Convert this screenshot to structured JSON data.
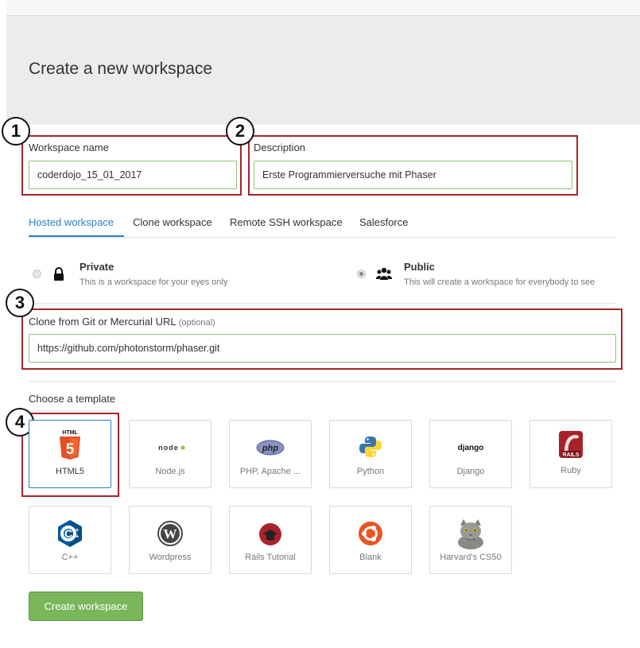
{
  "header": {
    "title": "Create a new workspace"
  },
  "annotations": [
    "1",
    "2",
    "3",
    "4"
  ],
  "workspace_name": {
    "label": "Workspace name",
    "value": "coderdojo_15_01_2017"
  },
  "description": {
    "label": "Description",
    "value": "Erste Programmierversuche mit Phaser"
  },
  "tabs": [
    {
      "label": "Hosted workspace",
      "active": true
    },
    {
      "label": "Clone workspace",
      "active": false
    },
    {
      "label": "Remote SSH workspace",
      "active": false
    },
    {
      "label": "Salesforce",
      "active": false
    }
  ],
  "visibility": {
    "private": {
      "title": "Private",
      "desc": "This is a workspace for your eyes only",
      "selected": false,
      "icon": "lock-icon"
    },
    "public": {
      "title": "Public",
      "desc": "This will create a workspace for everybody to see",
      "selected": true,
      "icon": "users-icon"
    }
  },
  "clone": {
    "label": "Clone from Git or Mercurial URL",
    "optional": "(optional)",
    "value": "https://github.com/photonstorm/phaser.git"
  },
  "templates": {
    "heading": "Choose a template",
    "icon_glyphs": {
      "html5": "5",
      "html5_caption": "HTML",
      "nodejs": "node",
      "php": "php",
      "django": "django",
      "ruby": "RAILS",
      "cpp": "C",
      "wordpress": "W"
    },
    "items": [
      {
        "name": "HTML5",
        "icon": "html5-icon",
        "selected": true
      },
      {
        "name": "Node.js",
        "icon": "nodejs-icon",
        "selected": false
      },
      {
        "name": "PHP, Apache ...",
        "icon": "php-icon",
        "selected": false
      },
      {
        "name": "Python",
        "icon": "python-icon",
        "selected": false
      },
      {
        "name": "Django",
        "icon": "django-icon",
        "selected": false
      },
      {
        "name": "Ruby",
        "icon": "ruby-icon",
        "selected": false
      },
      {
        "name": "C++",
        "icon": "cpp-icon",
        "selected": false
      },
      {
        "name": "Wordpress",
        "icon": "wordpress-icon",
        "selected": false
      },
      {
        "name": "Rails Tutorial",
        "icon": "rails-tutorial-icon",
        "selected": false
      },
      {
        "name": "Blank",
        "icon": "ubuntu-icon",
        "selected": false
      },
      {
        "name": "Harvard's CS50",
        "icon": "cat-icon",
        "selected": false
      }
    ]
  },
  "colors": {
    "accent": "#2d7fc0",
    "button": "#79b75a",
    "annotation": "#a4262c",
    "input_border": "#8cc476"
  },
  "create_button": {
    "label": "Create workspace"
  }
}
